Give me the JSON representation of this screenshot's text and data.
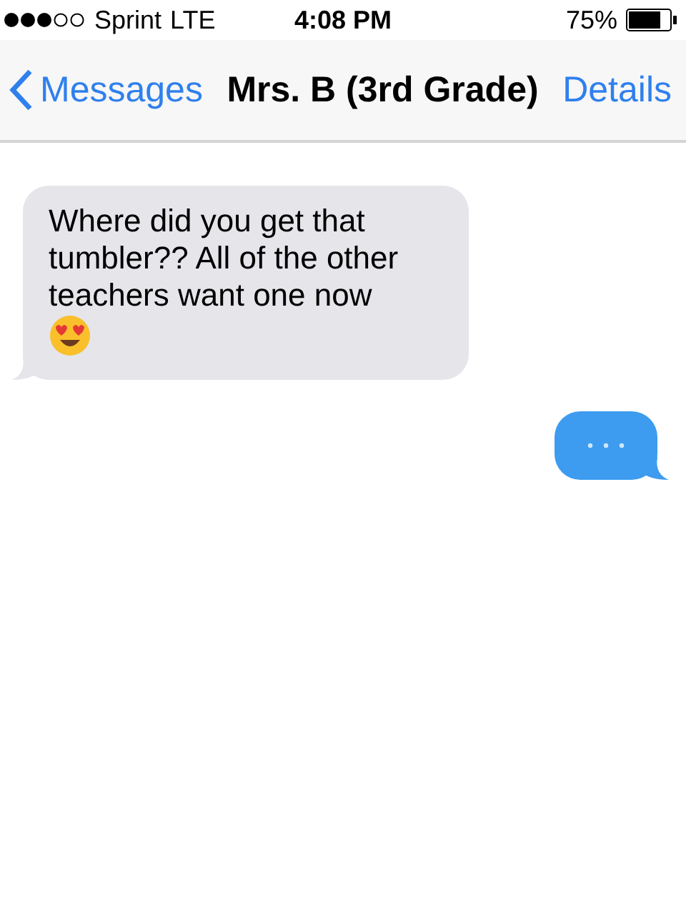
{
  "status_bar": {
    "carrier": "Sprint",
    "network": "LTE",
    "time": "4:08 PM",
    "battery": "75%"
  },
  "nav_bar": {
    "back": "Messages",
    "title": "Mrs. B (3rd Grade)",
    "action": "Details"
  },
  "messages": [
    {
      "kind": "received",
      "text": "Where did you get that tumbler?? All of the other teachers want one now",
      "emoji": true
    },
    {
      "kind": "typing"
    }
  ]
}
